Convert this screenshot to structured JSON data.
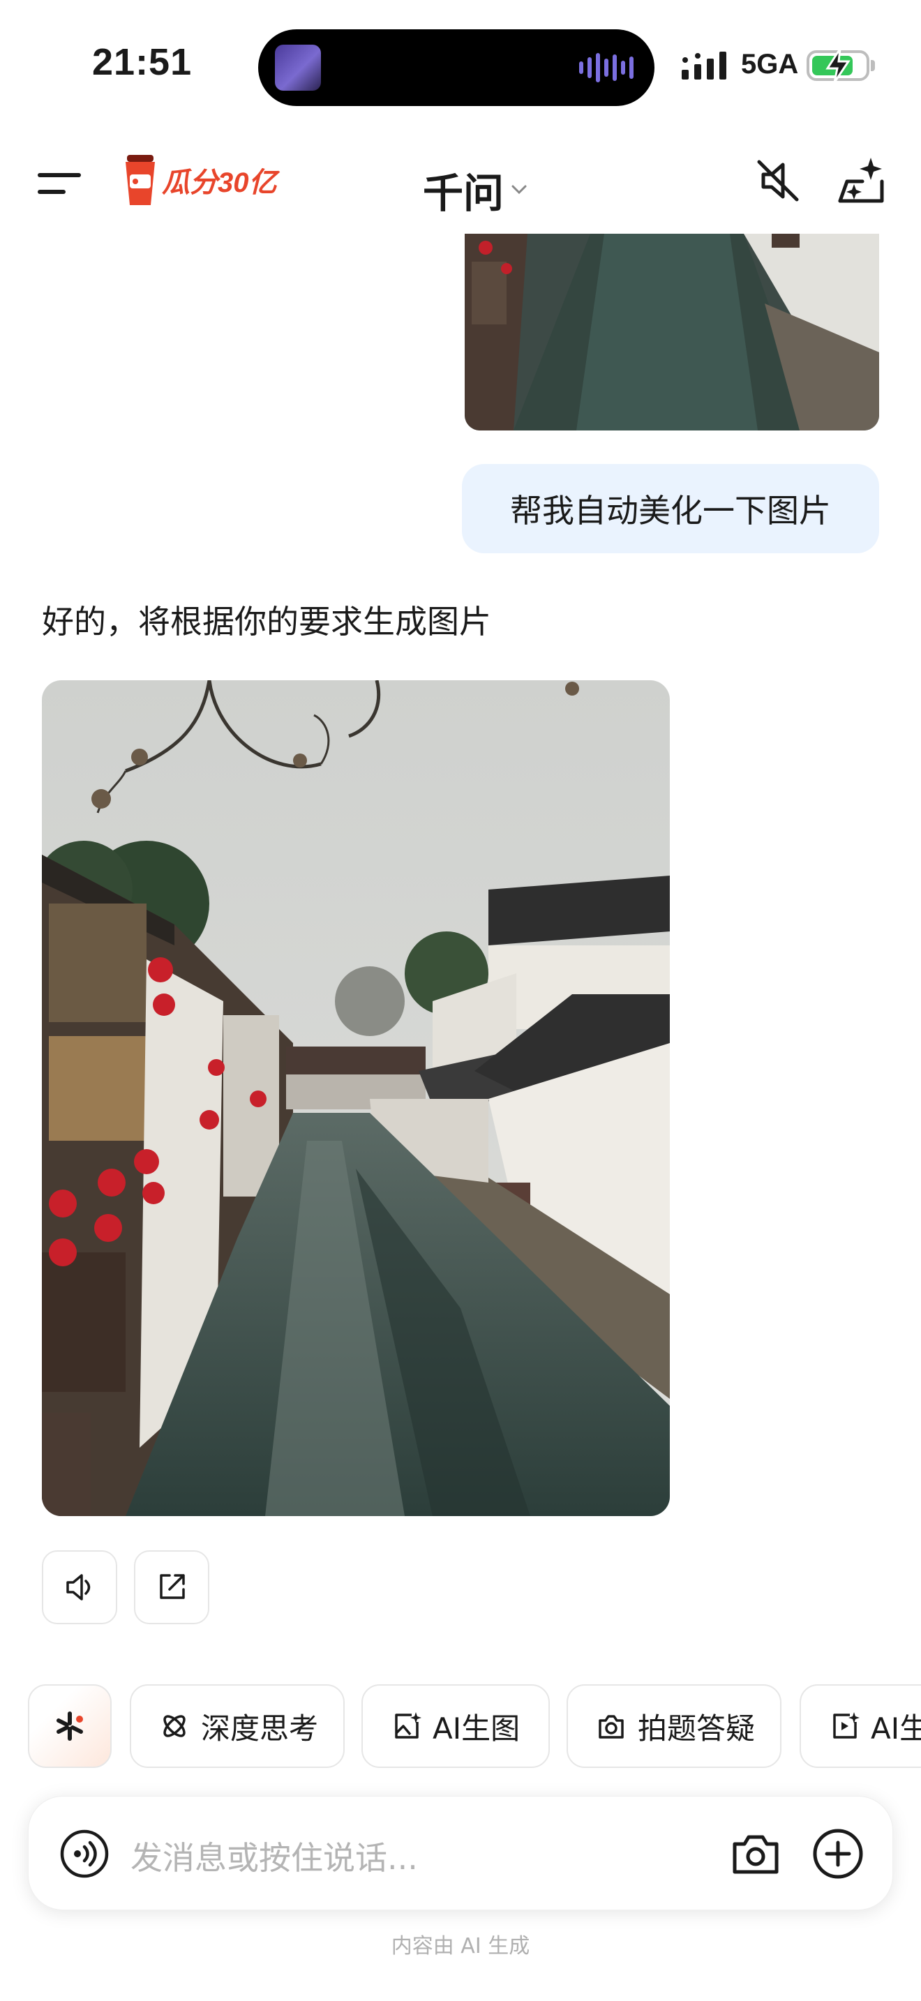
{
  "status_bar": {
    "time": "21:51",
    "network": "5GA",
    "battery_level": 0.78
  },
  "header": {
    "brand_label": "瓜分30亿",
    "title": "千问"
  },
  "conversation": {
    "user_message": "帮我自动美化一下图片",
    "assistant_message": "好的，将根据你的要求生成图片"
  },
  "quick_actions": [
    {
      "label": "深度思考",
      "icon": "deep-think-icon"
    },
    {
      "label": "AI生图",
      "icon": "image-gen-icon"
    },
    {
      "label": "拍题答疑",
      "icon": "camera-question-icon"
    },
    {
      "label": "AI生",
      "icon": "video-gen-icon"
    }
  ],
  "input": {
    "placeholder": "发消息或按住说话..."
  },
  "footer": {
    "disclaimer": "内容由 AI 生成"
  },
  "colors": {
    "accent": "#e8452b",
    "bubble": "#eaf3fe",
    "battery": "#34c759"
  }
}
